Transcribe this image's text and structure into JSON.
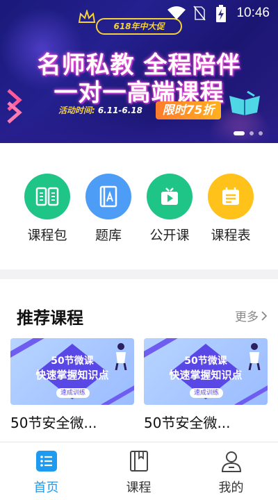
{
  "status_bar": {
    "time": "10:46"
  },
  "banner": {
    "promo_tag": "618年中大促",
    "headline_line1": "名师私教 全程陪伴",
    "headline_line2": "一对一高端课程",
    "date_label": "活动时间:",
    "date_value": "6.11-6.18",
    "badge": "限时75折",
    "slide_count": 3,
    "active_slide": 1
  },
  "quick_entries": [
    {
      "label": "课程包",
      "icon": "book-open-icon",
      "color": "#1fc487"
    },
    {
      "label": "题库",
      "icon": "question-bank-icon",
      "color": "#4d9cf6"
    },
    {
      "label": "公开课",
      "icon": "video-play-icon",
      "color": "#1fc487"
    },
    {
      "label": "课程表",
      "icon": "calendar-icon",
      "color": "#ffc21a"
    }
  ],
  "recommended": {
    "title": "推荐课程",
    "more_label": "更多",
    "courses": [
      {
        "thumb_line1": "50节微课",
        "thumb_line2": "快速掌握知识点",
        "thumb_tag": "速成训练",
        "title": "50节安全微..."
      },
      {
        "thumb_line1": "50节微课",
        "thumb_line2": "快速掌握知识点",
        "thumb_tag": "速成训练",
        "title": "50节安全微..."
      }
    ]
  },
  "tabbar": {
    "active_color": "#1e9af0",
    "items": [
      {
        "label": "首页",
        "icon": "home-list-icon",
        "active": true
      },
      {
        "label": "课程",
        "icon": "notebook-icon",
        "active": false
      },
      {
        "label": "我的",
        "icon": "user-icon",
        "active": false
      }
    ]
  }
}
